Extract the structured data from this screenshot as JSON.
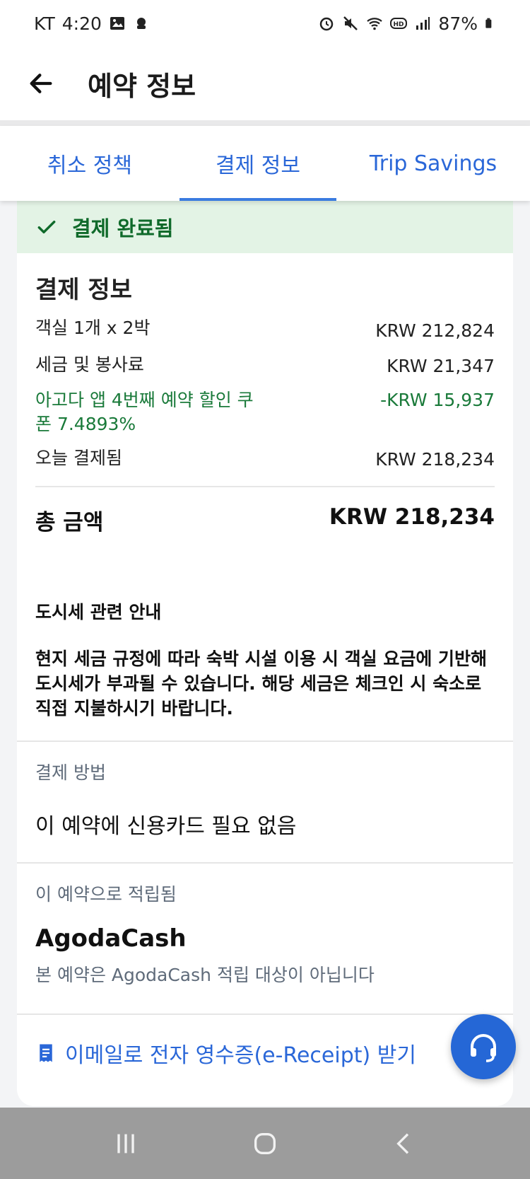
{
  "status_bar": {
    "carrier": "KT",
    "time": "4:20",
    "battery": "87%",
    "icons": [
      "image-icon",
      "notification-icon",
      "alarm-icon",
      "mute-icon",
      "wifi-icon",
      "hd-icon",
      "signal-icon",
      "battery-icon"
    ]
  },
  "app_bar": {
    "title": "예약 정보"
  },
  "tabs": [
    {
      "label": "취소 정책",
      "active": false
    },
    {
      "label": "결제 정보",
      "active": true
    },
    {
      "label": "Trip Savings",
      "active": false
    }
  ],
  "banner": {
    "text": "결제 완료됨"
  },
  "payment": {
    "title": "결제 정보",
    "rows": [
      {
        "label": "객실 1개 x 2박",
        "value": "KRW 212,824"
      },
      {
        "label": "세금 및 봉사료",
        "value": "KRW 21,347"
      },
      {
        "label": "아고다 앱 4번째 예약 할인 쿠폰 7.4893%",
        "value": "-KRW 15,937"
      },
      {
        "label": "오늘 결제됨",
        "value": "KRW 218,234"
      }
    ],
    "total_label": "총 금액",
    "total_value": "KRW 218,234"
  },
  "city_tax": {
    "title": "도시세 관련 안내",
    "body": "현지 세금 규정에 따라 숙박 시설 이용 시 객실 요금에 기반해 도시세가 부과될 수 있습니다. 해당 세금은 체크인 시 숙소로 직접 지불하시기 바랍니다."
  },
  "payment_method": {
    "label": "결제 방법",
    "value": "이 예약에 신용카드 필요 없음"
  },
  "rewards": {
    "label": "이 예약으로 적립됨",
    "title": "AgodaCash",
    "desc": "본 예약은 AgodaCash 적립 대상이 아닙니다"
  },
  "receipt": {
    "label": "이메일로 전자 영수증(e-Receipt) 받기"
  },
  "colors": {
    "accent": "#2a67d8",
    "success_bg": "#e3f3e5",
    "success_text": "#0f6a2a",
    "discount": "#1a7a3a"
  }
}
